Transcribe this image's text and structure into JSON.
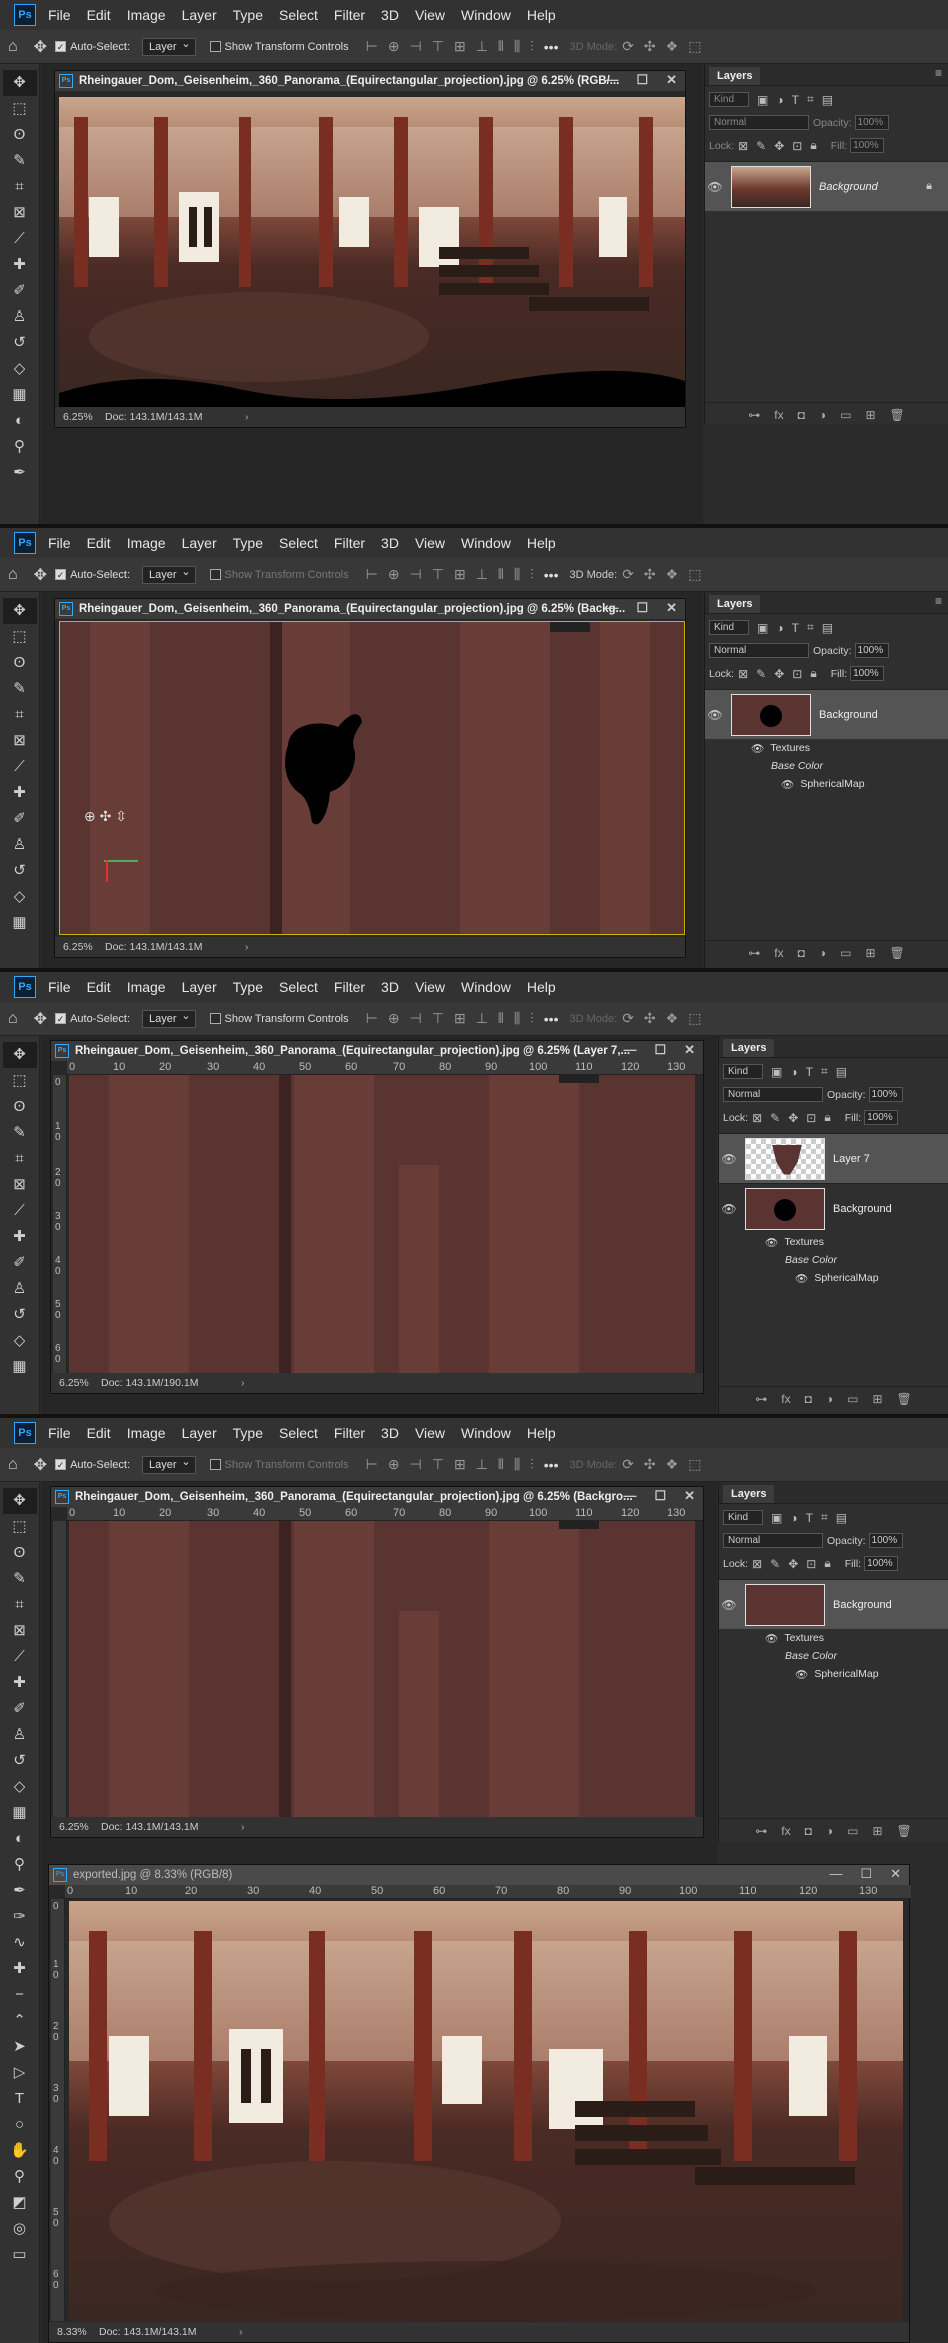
{
  "menu": {
    "logo": "Ps",
    "items": [
      "File",
      "Edit",
      "Image",
      "Layer",
      "Type",
      "Select",
      "Filter",
      "3D",
      "View",
      "Window",
      "Help"
    ]
  },
  "options": {
    "auto_select": "Auto-Select:",
    "layer_select": "Layer",
    "transform": "Show Transform Controls",
    "mode3d": "3D Mode:"
  },
  "layers_panel": {
    "tab": "Layers",
    "kind": "Kind",
    "blend": "Normal",
    "opacity_label": "Opacity:",
    "opacity": "100%",
    "lock_label": "Lock:",
    "fill_label": "Fill:",
    "fill": "100%"
  },
  "panels": [
    {
      "title": "Rheingauer_Dom,_Geisenheim,_360_Panorama_(Equirectangular_projection).jpg @ 6.25% (RGB/...",
      "zoom": "6.25%",
      "doc": "Doc: 143.1M/143.1M",
      "layers": [
        {
          "name": "Background",
          "italic": true,
          "locked": true
        }
      ],
      "sub": []
    },
    {
      "title": "Rheingauer_Dom,_Geisenheim,_360_Panorama_(Equirectangular_projection).jpg @ 6.25% (Backg...",
      "zoom": "6.25%",
      "doc": "Doc: 143.1M/143.1M",
      "layers": [
        {
          "name": "Background",
          "italic": false,
          "locked": false
        }
      ],
      "sub": [
        "Textures",
        "Base Color",
        "SphericalMap"
      ]
    },
    {
      "title": "Rheingauer_Dom,_Geisenheim,_360_Panorama_(Equirectangular_projection).jpg @ 6.25% (Layer 7,...",
      "zoom": "6.25%",
      "doc": "Doc: 143.1M/190.1M",
      "layers": [
        {
          "name": "Layer 7",
          "italic": false,
          "locked": false
        },
        {
          "name": "Background",
          "italic": false,
          "locked": false
        }
      ],
      "sub": [
        "Textures",
        "Base Color",
        "SphericalMap"
      ]
    },
    {
      "title": "Rheingauer_Dom,_Geisenheim,_360_Panorama_(Equirectangular_projection).jpg @ 6.25% (Backgro...",
      "zoom": "6.25%",
      "doc": "Doc: 143.1M/143.1M",
      "layers": [
        {
          "name": "Background",
          "italic": false,
          "locked": false
        }
      ],
      "sub": [
        "Textures",
        "Base Color",
        "SphericalMap"
      ]
    }
  ],
  "export_window": {
    "title": "exported.jpg @ 8.33% (RGB/8)",
    "zoom": "8.33%",
    "doc": "Doc: 143.1M/143.1M"
  },
  "ruler_h": [
    "0",
    "10",
    "20",
    "30",
    "40",
    "50",
    "60",
    "70",
    "80",
    "90",
    "100",
    "110",
    "120",
    "130"
  ],
  "ruler_v": [
    "0",
    "1\n0",
    "2\n0",
    "3\n0",
    "4\n0",
    "5\n0",
    "6\n0"
  ]
}
